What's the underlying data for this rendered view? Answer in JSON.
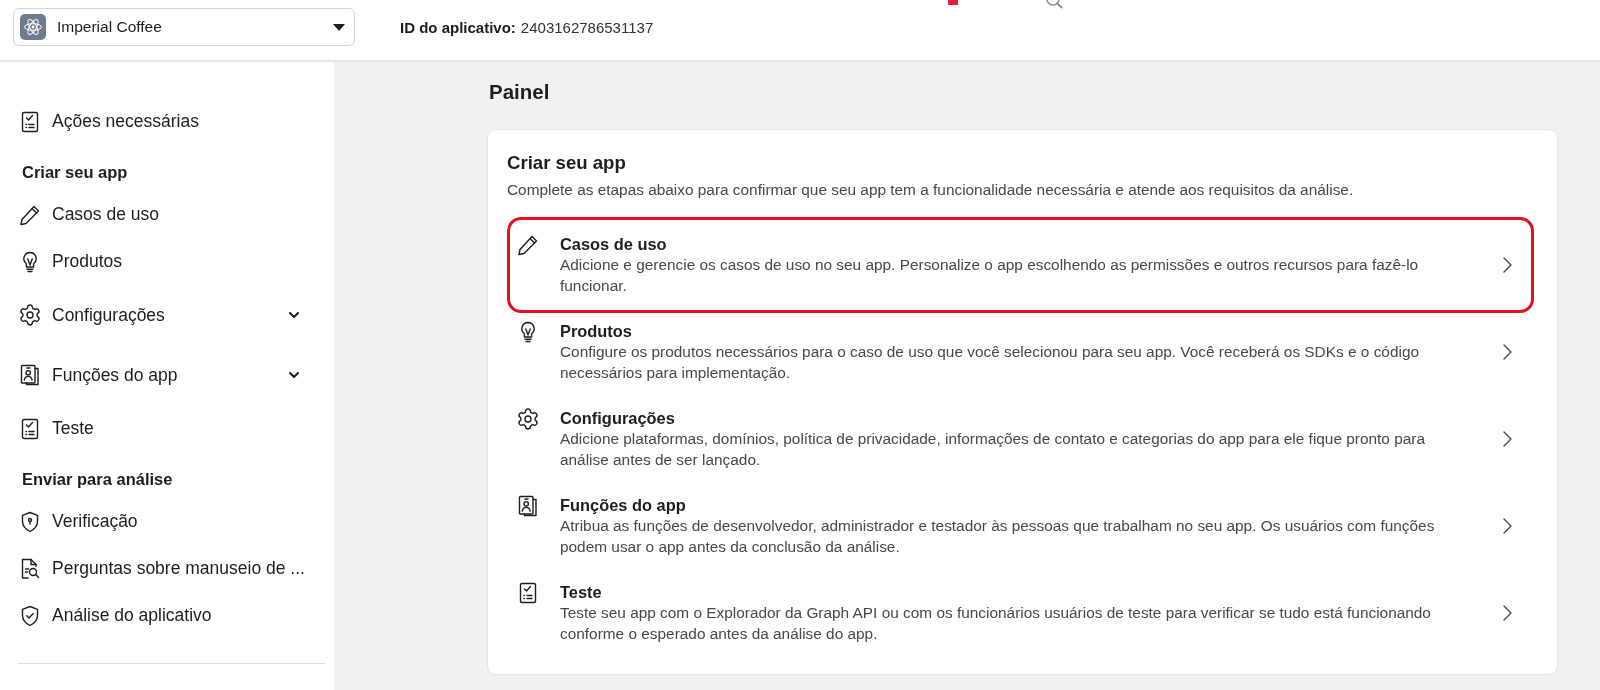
{
  "app_selector": {
    "name": "Imperial Coffee"
  },
  "app_id": {
    "label": "ID do aplicativo:",
    "value": "2403162786531137"
  },
  "sidebar": {
    "sections": [
      {
        "items": [
          {
            "label": "Ações necessárias",
            "expandable": false
          }
        ]
      },
      {
        "heading": "Criar seu app",
        "items": [
          {
            "label": "Casos de uso",
            "expandable": false
          },
          {
            "label": "Produtos",
            "expandable": false
          },
          {
            "label": "Configurações",
            "expandable": true,
            "expanded": false
          },
          {
            "label": "Funções do app",
            "expandable": true,
            "expanded": false
          },
          {
            "label": "Teste",
            "expandable": false
          }
        ]
      },
      {
        "heading": "Enviar para análise",
        "items": [
          {
            "label": "Verificação",
            "expandable": false
          },
          {
            "label": "Perguntas sobre manuseio de ...",
            "expandable": false
          },
          {
            "label": "Análise do aplicativo",
            "expandable": false
          }
        ]
      }
    ]
  },
  "page_title": "Painel",
  "card": {
    "title": "Criar seu app",
    "description": "Complete as etapas abaixo para confirmar que seu app tem a funcionalidade necessária e atende aos requisitos da análise.",
    "items": [
      {
        "title": "Casos de uso",
        "description": "Adicione e gerencie os casos de uso no seu app. Personalize o app escolhendo as permissões e outros recursos para fazê-lo funcionar.",
        "highlighted": true
      },
      {
        "title": "Produtos",
        "description": "Configure os produtos necessários para o caso de uso que você selecionou para seu app. Você receberá os SDKs e o código necessários para implementação.",
        "highlighted": false
      },
      {
        "title": "Configurações",
        "description": "Adicione plataformas, domínios, política de privacidade, informações de contato e categorias do app para ele fique pronto para análise antes de ser lançado.",
        "highlighted": false
      },
      {
        "title": "Funções do app",
        "description": "Atribua as funções de desenvolvedor, administrador e testador às pessoas que trabalham no seu app. Os usuários com funções podem usar o app antes da conclusão da análise.",
        "highlighted": false
      },
      {
        "title": "Teste",
        "description": "Teste seu app com o Explorador da Graph API ou com os funcionários usuários de teste para verificar se tudo está funcionando conforme o esperado antes da análise do app.",
        "highlighted": false
      }
    ]
  }
}
